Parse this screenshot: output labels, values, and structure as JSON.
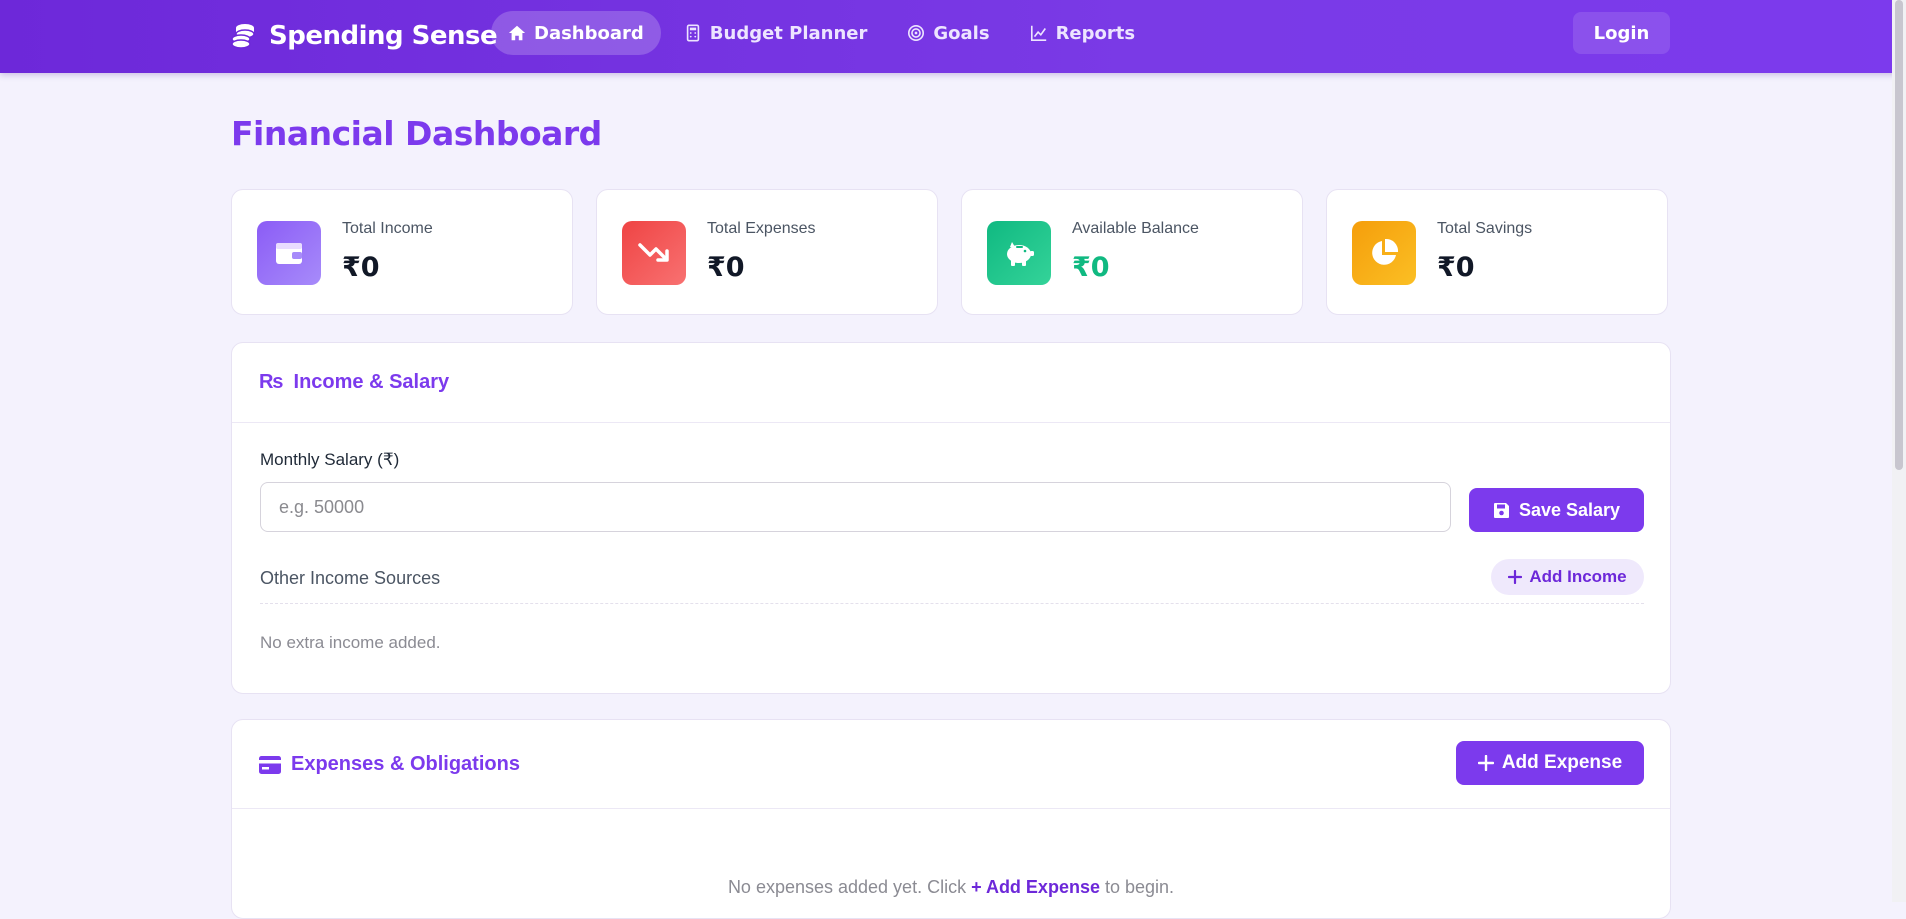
{
  "navbar": {
    "brand": "Spending Sense",
    "links": [
      {
        "label": "Dashboard",
        "icon": "home-icon",
        "active": true
      },
      {
        "label": "Budget Planner",
        "icon": "calculator-icon",
        "active": false
      },
      {
        "label": "Goals",
        "icon": "target-icon",
        "active": false
      },
      {
        "label": "Reports",
        "icon": "line-chart-icon",
        "active": false
      }
    ],
    "login_label": "Login"
  },
  "page": {
    "title": "Financial Dashboard"
  },
  "stats": [
    {
      "label": "Total Income",
      "value": "₹0",
      "icon": "wallet-icon",
      "color": "#8b5cf6",
      "value_color": "#111827"
    },
    {
      "label": "Total Expenses",
      "value": "₹0",
      "icon": "trending-down-icon",
      "color": "#ef4444",
      "value_color": "#111827"
    },
    {
      "label": "Available Balance",
      "value": "₹0",
      "icon": "piggy-bank-icon",
      "color": "#10b981",
      "value_color": "#10b981"
    },
    {
      "label": "Total Savings",
      "value": "₹0",
      "icon": "pie-chart-icon",
      "color": "#f59e0b",
      "value_color": "#111827"
    }
  ],
  "income": {
    "title_symbol": "₨",
    "title": "Income & Salary",
    "salary_label": "Monthly Salary (₹)",
    "salary_placeholder": "e.g. 50000",
    "salary_value": "",
    "save_label": "Save Salary",
    "other_label": "Other Income Sources",
    "add_income_label": "Add Income",
    "empty_text": "No extra income added."
  },
  "expenses": {
    "title": "Expenses & Obligations",
    "add_label": "Add Expense",
    "empty_before": "No expenses added yet. Click",
    "empty_link": "+ Add Expense",
    "empty_after": "to begin."
  },
  "colors": {
    "accent": "#7c3aed",
    "nav_bg": "#6d28d9",
    "page_bg": "#f4f2fd"
  }
}
